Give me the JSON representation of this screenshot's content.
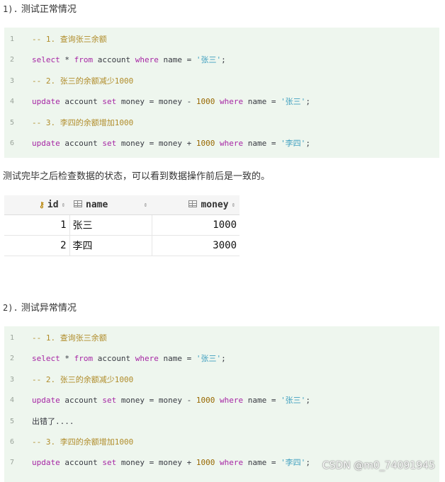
{
  "section1": {
    "heading_num": "1).",
    "heading_text": "测试正常情况",
    "lines": [
      {
        "n": "1",
        "parts": [
          {
            "t": "-- 1. 查询张三余额",
            "c": "cm"
          }
        ]
      },
      {
        "n": "2",
        "parts": [
          {
            "t": "select",
            "c": "kw"
          },
          {
            "t": " * ",
            "c": ""
          },
          {
            "t": "from",
            "c": "kw"
          },
          {
            "t": " account ",
            "c": ""
          },
          {
            "t": "where",
            "c": "kw"
          },
          {
            "t": " name = ",
            "c": ""
          },
          {
            "t": "'张三'",
            "c": "str"
          },
          {
            "t": ";",
            "c": ""
          }
        ]
      },
      {
        "n": "3",
        "parts": [
          {
            "t": "-- 2. 张三的余额减少1000",
            "c": "cm"
          }
        ]
      },
      {
        "n": "4",
        "parts": [
          {
            "t": "update",
            "c": "kw"
          },
          {
            "t": " account ",
            "c": ""
          },
          {
            "t": "set",
            "c": "kw"
          },
          {
            "t": " money = money - ",
            "c": ""
          },
          {
            "t": "1000",
            "c": "nb"
          },
          {
            "t": " ",
            "c": ""
          },
          {
            "t": "where",
            "c": "kw"
          },
          {
            "t": " name = ",
            "c": ""
          },
          {
            "t": "'张三'",
            "c": "str"
          },
          {
            "t": ";",
            "c": ""
          }
        ]
      },
      {
        "n": "5",
        "parts": [
          {
            "t": "-- 3. 李四的余额增加1000",
            "c": "cm"
          }
        ]
      },
      {
        "n": "6",
        "parts": [
          {
            "t": "update",
            "c": "kw"
          },
          {
            "t": " account ",
            "c": ""
          },
          {
            "t": "set",
            "c": "kw"
          },
          {
            "t": " money = money + ",
            "c": ""
          },
          {
            "t": "1000",
            "c": "nb"
          },
          {
            "t": " ",
            "c": ""
          },
          {
            "t": "where",
            "c": "kw"
          },
          {
            "t": " name = ",
            "c": ""
          },
          {
            "t": "'李四'",
            "c": "str"
          },
          {
            "t": ";",
            "c": ""
          }
        ]
      }
    ]
  },
  "paragraph": "测试完毕之后检查数据的状态，可以看到数据操作前后是一致的。",
  "table": {
    "columns": [
      "id",
      "name",
      "money"
    ],
    "rows": [
      [
        "1",
        "张三",
        "1000"
      ],
      [
        "2",
        "李四",
        "3000"
      ]
    ]
  },
  "section2": {
    "heading_num": "2).",
    "heading_text": "测试异常情况",
    "lines": [
      {
        "n": "1",
        "parts": [
          {
            "t": "-- 1. 查询张三余额",
            "c": "cm"
          }
        ]
      },
      {
        "n": "2",
        "parts": [
          {
            "t": "select",
            "c": "kw"
          },
          {
            "t": " * ",
            "c": ""
          },
          {
            "t": "from",
            "c": "kw"
          },
          {
            "t": " account ",
            "c": ""
          },
          {
            "t": "where",
            "c": "kw"
          },
          {
            "t": " name = ",
            "c": ""
          },
          {
            "t": "'张三'",
            "c": "str"
          },
          {
            "t": ";",
            "c": ""
          }
        ]
      },
      {
        "n": "3",
        "parts": [
          {
            "t": "-- 2. 张三的余额减少1000",
            "c": "cm"
          }
        ]
      },
      {
        "n": "4",
        "parts": [
          {
            "t": "update",
            "c": "kw"
          },
          {
            "t": " account ",
            "c": ""
          },
          {
            "t": "set",
            "c": "kw"
          },
          {
            "t": " money = money - ",
            "c": ""
          },
          {
            "t": "1000",
            "c": "nb"
          },
          {
            "t": " ",
            "c": ""
          },
          {
            "t": "where",
            "c": "kw"
          },
          {
            "t": " name = ",
            "c": ""
          },
          {
            "t": "'张三'",
            "c": "str"
          },
          {
            "t": ";",
            "c": ""
          }
        ]
      },
      {
        "n": "5",
        "parts": [
          {
            "t": "出错了....",
            "c": ""
          }
        ]
      },
      {
        "n": "6",
        "parts": [
          {
            "t": "-- 3. 李四的余额增加1000",
            "c": "cm"
          }
        ]
      },
      {
        "n": "7",
        "parts": [
          {
            "t": "update",
            "c": "kw"
          },
          {
            "t": " account ",
            "c": ""
          },
          {
            "t": "set",
            "c": "kw"
          },
          {
            "t": " money = money + ",
            "c": ""
          },
          {
            "t": "1000",
            "c": "nb"
          },
          {
            "t": " ",
            "c": ""
          },
          {
            "t": "where",
            "c": "kw"
          },
          {
            "t": " name = ",
            "c": ""
          },
          {
            "t": "'李四'",
            "c": "str"
          },
          {
            "t": ";",
            "c": ""
          }
        ]
      }
    ]
  },
  "watermark": "CSDN @m0_74091945"
}
